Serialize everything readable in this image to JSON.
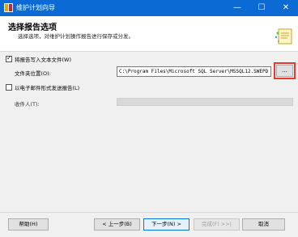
{
  "window": {
    "title": "维护计划向导",
    "minimize": "—",
    "maximize": "☐",
    "close": "✕",
    "titlebar_color": "#0b6ad4"
  },
  "header": {
    "title": "选择报告选项",
    "subtitle": "选择选项，对维护计划操作报告进行保存或分发。",
    "icon": "wizard-report-icon"
  },
  "options": {
    "write_report_label": "将报告写入文本文件(W)",
    "write_report_checked": true,
    "folder_label": "文件夹位置(O):",
    "folder_value": "C:\\Program Files\\Microsoft SQL Server\\MSSQL12.SWEPD",
    "browse_label": "...",
    "email_label": "以电子邮件形式发送报告(L)",
    "email_checked": false,
    "recipient_label": "收件人(T):"
  },
  "footer": {
    "help": "帮助(H)",
    "back": "< 上一步(B)",
    "next": "下一步(N) >",
    "finish": "完成(F) >>|",
    "cancel": "取消"
  },
  "highlight_color": "#e53935"
}
